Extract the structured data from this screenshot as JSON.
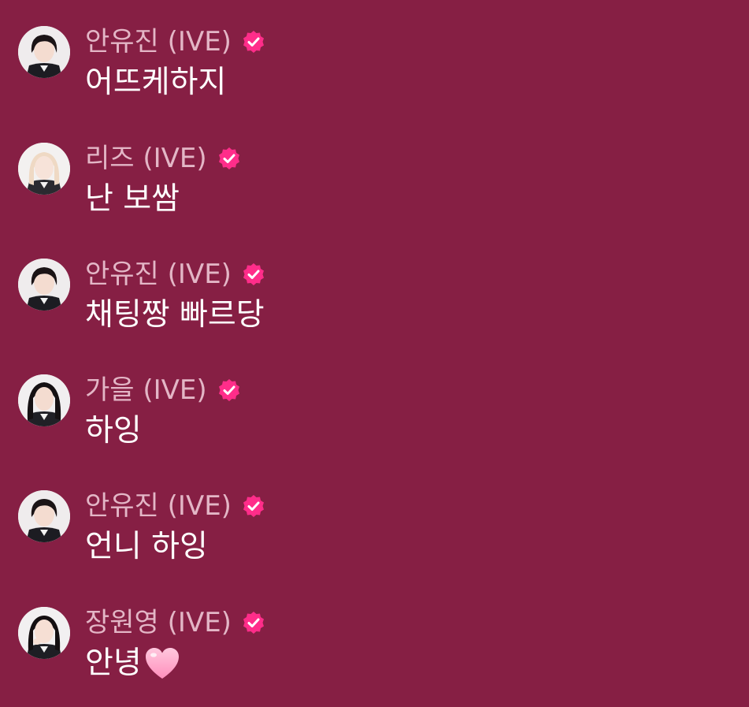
{
  "colors": {
    "background": "#861f44",
    "name_text": "#e3b6c6",
    "message_text": "#ffffff",
    "verified_badge": "#ff2d8a",
    "heart": "#ffb3d1"
  },
  "messages": [
    {
      "author": "안유진 (IVE)",
      "verified": true,
      "text": "어뜨케하지",
      "avatar": "avatar-anyujin"
    },
    {
      "author": "리즈 (IVE)",
      "verified": true,
      "text": "난 보쌈",
      "avatar": "avatar-liz"
    },
    {
      "author": "안유진 (IVE)",
      "verified": true,
      "text": "채팅짱 빠르당",
      "avatar": "avatar-anyujin"
    },
    {
      "author": "가을 (IVE)",
      "verified": true,
      "text": "하잉",
      "avatar": "avatar-gaeul"
    },
    {
      "author": "안유진 (IVE)",
      "verified": true,
      "text": "언니 하잉",
      "avatar": "avatar-anyujin"
    },
    {
      "author": "장원영 (IVE)",
      "verified": true,
      "text": "안녕",
      "avatar": "avatar-jangwonyoung",
      "trailing_emoji": "pink-heart-icon"
    }
  ]
}
